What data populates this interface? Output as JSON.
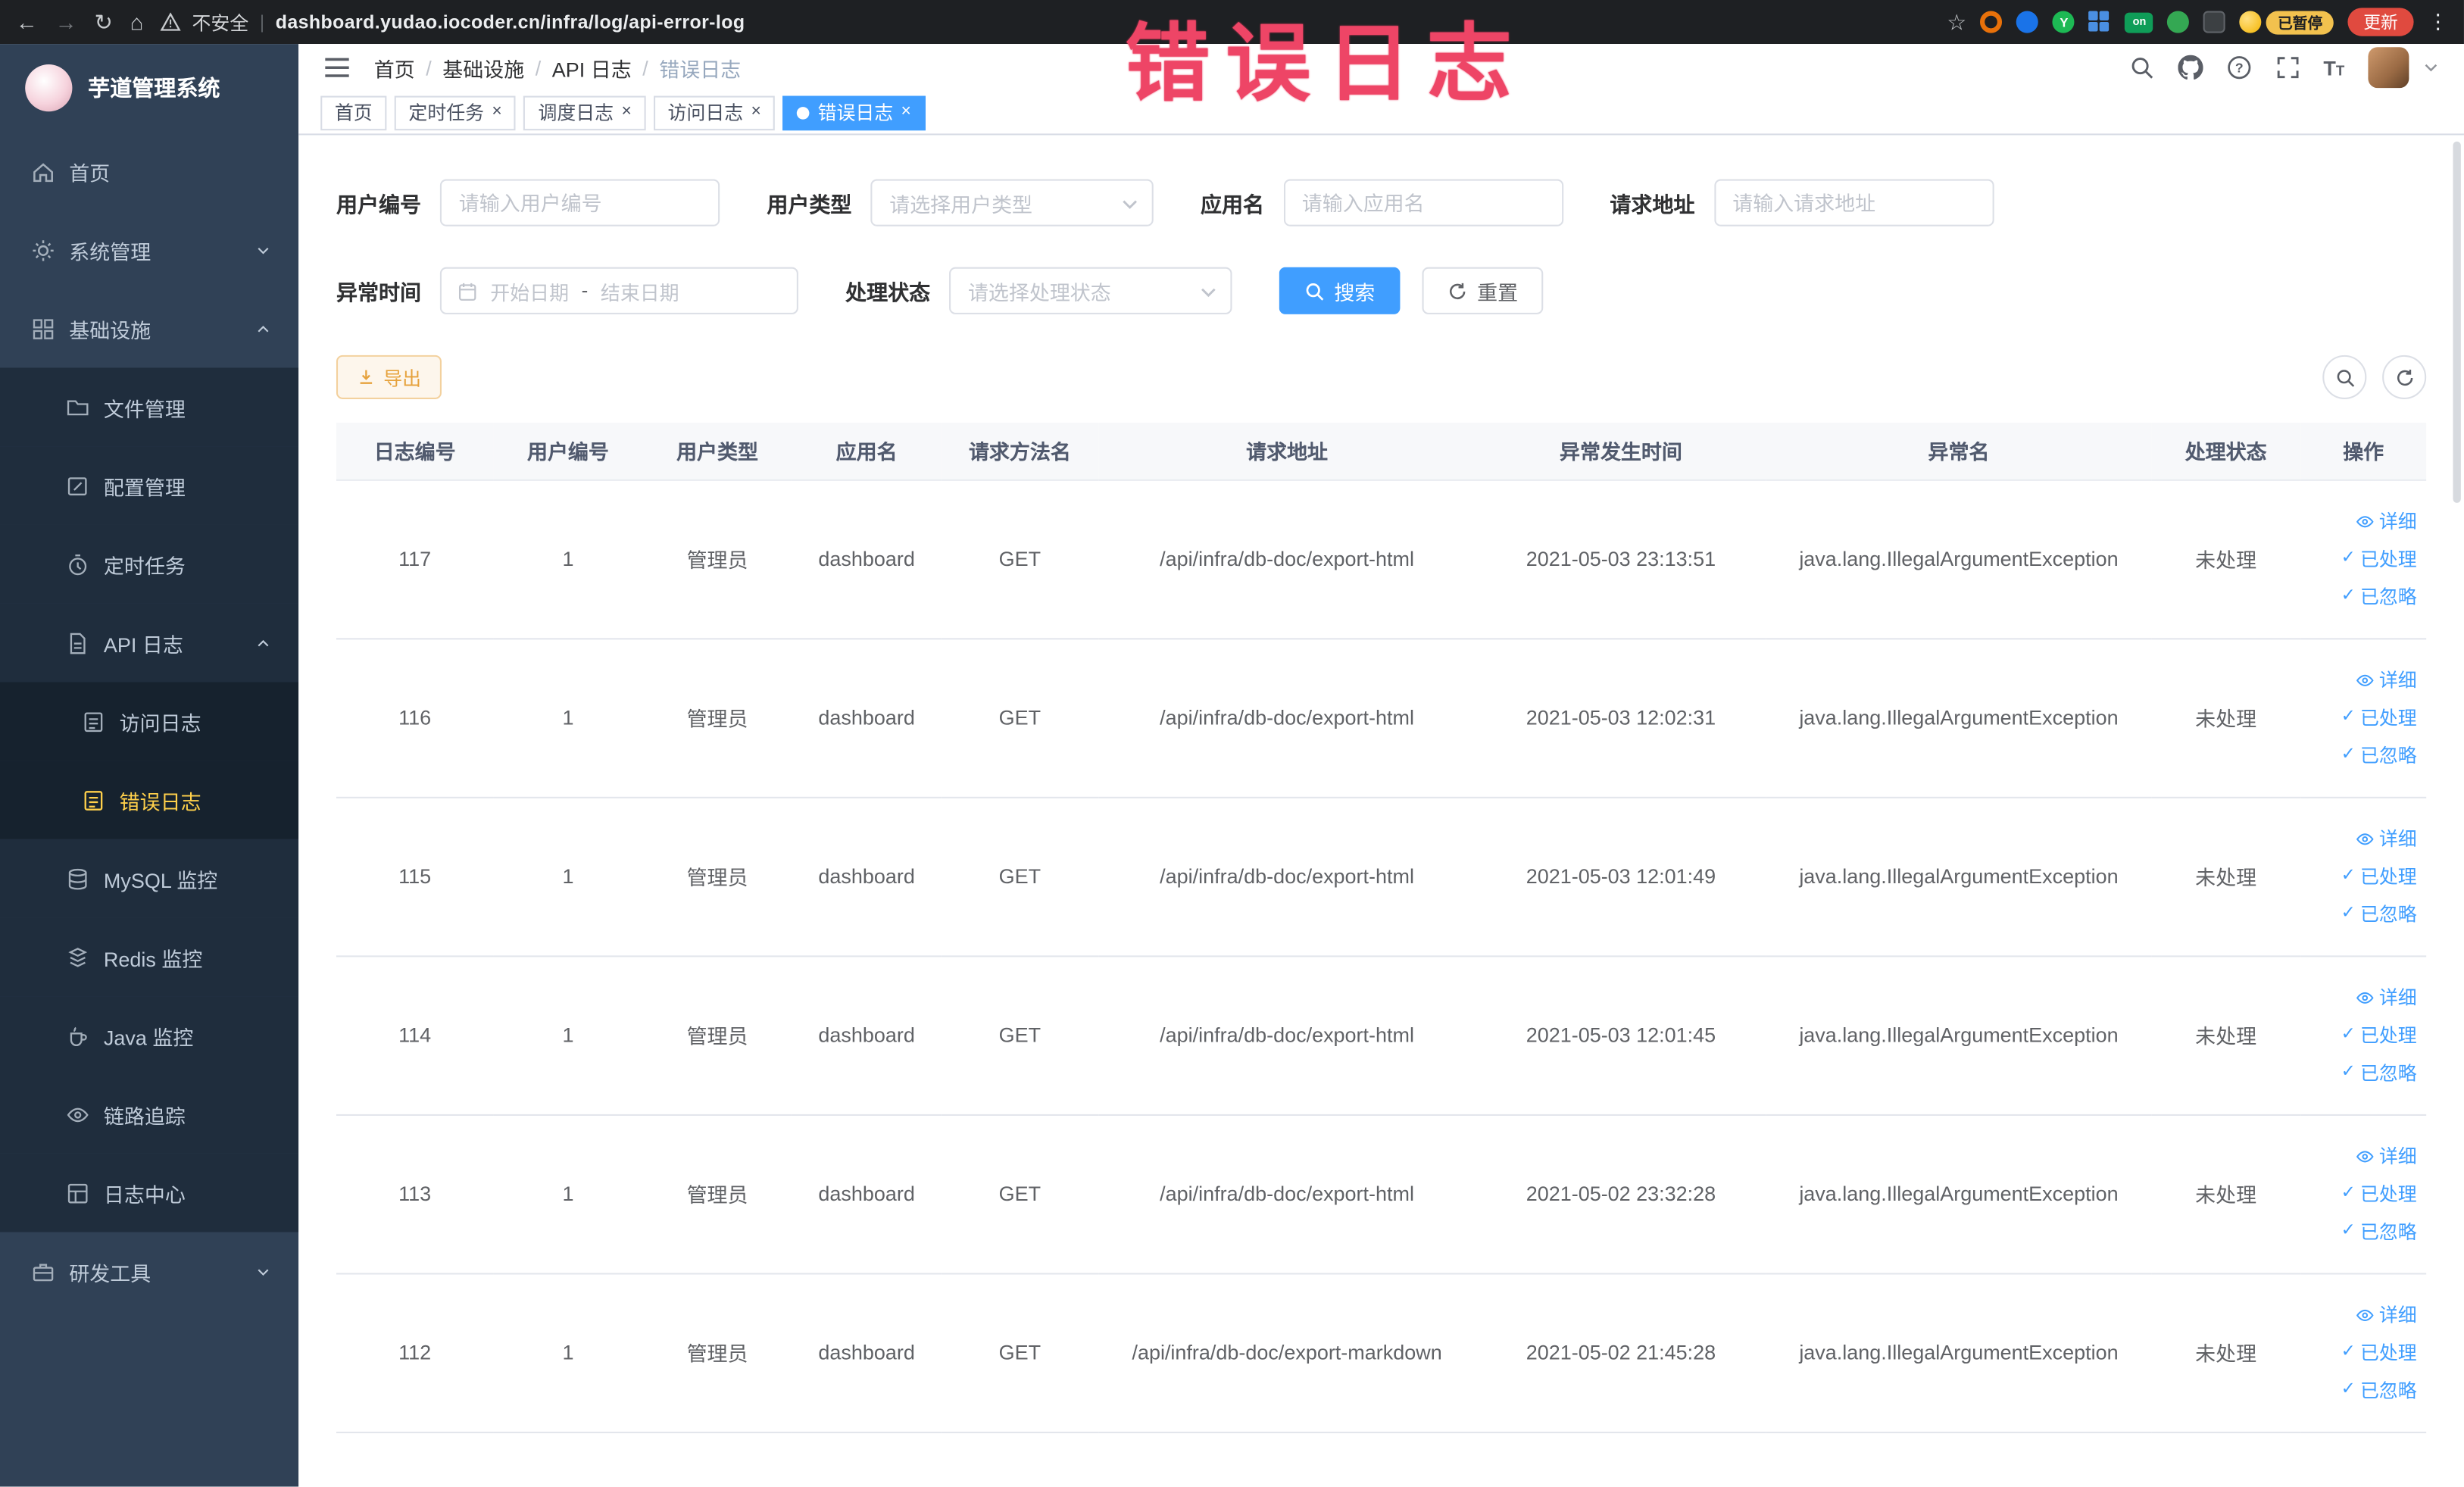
{
  "browser": {
    "security_label": "不安全",
    "url": "dashboard.yudao.iocoder.cn/infra/log/api-error-log",
    "extension_on_badge": "on",
    "paused_badge": "已暂停",
    "update_button": "更新"
  },
  "annotation": {
    "text": "错误日志",
    "color": "#ee4566"
  },
  "sidebar": {
    "title": "芋道管理系统",
    "items": [
      {
        "label": "首页"
      },
      {
        "label": "系统管理"
      },
      {
        "label": "基础设施"
      },
      {
        "label": "文件管理"
      },
      {
        "label": "配置管理"
      },
      {
        "label": "定时任务"
      },
      {
        "label": "API 日志"
      },
      {
        "label": "访问日志"
      },
      {
        "label": "错误日志"
      },
      {
        "label": "MySQL 监控"
      },
      {
        "label": "Redis 监控"
      },
      {
        "label": "Java 监控"
      },
      {
        "label": "链路追踪"
      },
      {
        "label": "日志中心"
      },
      {
        "label": "研发工具"
      }
    ]
  },
  "header": {
    "breadcrumb": [
      "首页",
      "基础设施",
      "API 日志",
      "错误日志"
    ]
  },
  "tabs": [
    {
      "label": "首页"
    },
    {
      "label": "定时任务"
    },
    {
      "label": "调度日志"
    },
    {
      "label": "访问日志"
    },
    {
      "label": "错误日志"
    }
  ],
  "filters": {
    "user_id": {
      "label": "用户编号",
      "placeholder": "请输入用户编号"
    },
    "user_type": {
      "label": "用户类型",
      "placeholder": "请选择用户类型"
    },
    "app_name": {
      "label": "应用名",
      "placeholder": "请输入应用名"
    },
    "request_url": {
      "label": "请求地址",
      "placeholder": "请输入请求地址"
    },
    "exception_time": {
      "label": "异常时间",
      "start": "开始日期",
      "separator": "-",
      "end": "结束日期"
    },
    "process_status": {
      "label": "处理状态",
      "placeholder": "请选择处理状态"
    },
    "search": "搜索",
    "reset": "重置"
  },
  "toolbar": {
    "export": "导出"
  },
  "table": {
    "columns": [
      "日志编号",
      "用户编号",
      "用户类型",
      "应用名",
      "请求方法名",
      "请求地址",
      "异常发生时间",
      "异常名",
      "处理状态",
      "操作"
    ],
    "actions": {
      "detail": "详细",
      "process": "已处理",
      "ignore": "已忽略"
    },
    "rows": [
      {
        "id": "117",
        "user_id": "1",
        "user_type": "管理员",
        "app": "dashboard",
        "method": "GET",
        "url": "/api/infra/db-doc/export-html",
        "time": "2021-05-03 23:13:51",
        "exception": "java.lang.IllegalArgumentException",
        "status": "未处理"
      },
      {
        "id": "116",
        "user_id": "1",
        "user_type": "管理员",
        "app": "dashboard",
        "method": "GET",
        "url": "/api/infra/db-doc/export-html",
        "time": "2021-05-03 12:02:31",
        "exception": "java.lang.IllegalArgumentException",
        "status": "未处理"
      },
      {
        "id": "115",
        "user_id": "1",
        "user_type": "管理员",
        "app": "dashboard",
        "method": "GET",
        "url": "/api/infra/db-doc/export-html",
        "time": "2021-05-03 12:01:49",
        "exception": "java.lang.IllegalArgumentException",
        "status": "未处理"
      },
      {
        "id": "114",
        "user_id": "1",
        "user_type": "管理员",
        "app": "dashboard",
        "method": "GET",
        "url": "/api/infra/db-doc/export-html",
        "time": "2021-05-03 12:01:45",
        "exception": "java.lang.IllegalArgumentException",
        "status": "未处理"
      },
      {
        "id": "113",
        "user_id": "1",
        "user_type": "管理员",
        "app": "dashboard",
        "method": "GET",
        "url": "/api/infra/db-doc/export-html",
        "time": "2021-05-02 23:32:28",
        "exception": "java.lang.IllegalArgumentException",
        "status": "未处理"
      },
      {
        "id": "112",
        "user_id": "1",
        "user_type": "管理员",
        "app": "dashboard",
        "method": "GET",
        "url": "/api/infra/db-doc/export-markdown",
        "time": "2021-05-02 21:45:28",
        "exception": "java.lang.IllegalArgumentException",
        "status": "未处理"
      }
    ]
  }
}
